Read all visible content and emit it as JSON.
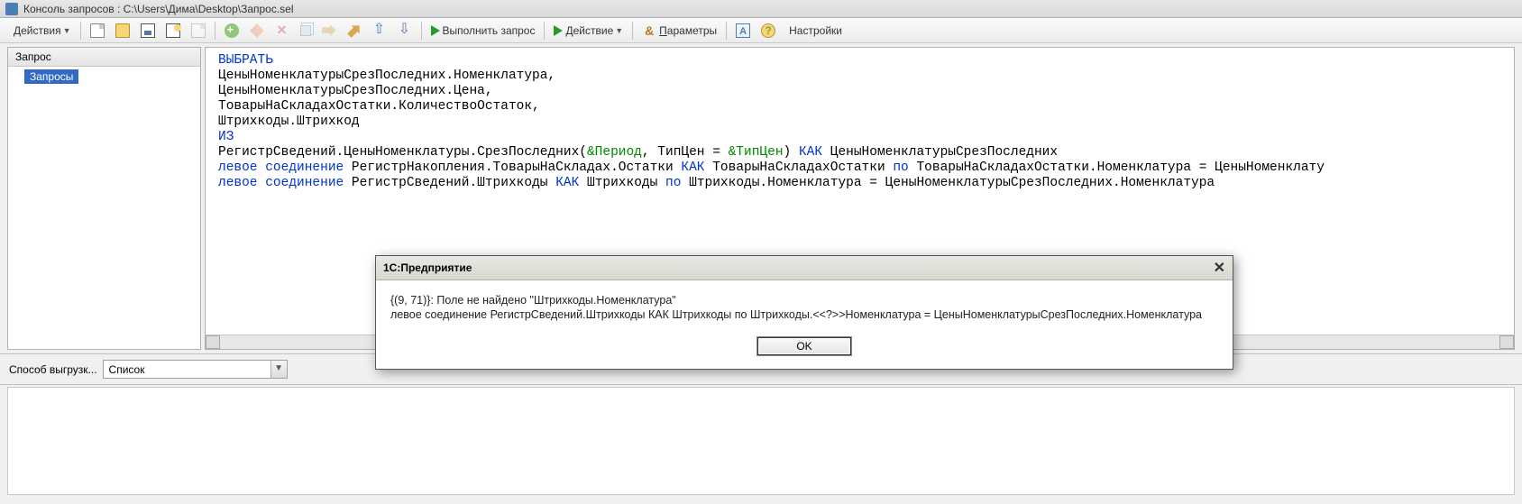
{
  "window": {
    "title": "Консоль запросов : C:\\Users\\Дима\\Desktop\\Запрос.sel"
  },
  "toolbar": {
    "actions_label": "Действия",
    "execute_label": "Выполнить запрос",
    "action_label": "Действие",
    "params_label": "Параметры",
    "settings_label": "Настройки"
  },
  "sidebar": {
    "header": "Запрос",
    "item": "Запросы"
  },
  "query": {
    "l1_kw": "ВЫБРАТЬ",
    "l2": "ЦеныНоменклатурыСрезПоследних.Номенклатура,",
    "l3": "ЦеныНоменклатурыСрезПоследних.Цена,",
    "l4": "ТоварыНаСкладахОстатки.КоличествоОстаток,",
    "l5": "Штрихкоды.Штрихкод",
    "l6_kw": "ИЗ",
    "l7a": "РегистрСведений.ЦеныНоменклатуры.СрезПоследних(",
    "l7p1": "&Период",
    "l7b": ", ТипЦен = ",
    "l7p2": "&ТипЦен",
    "l7c": ") ",
    "l7kw": "КАК",
    "l7d": " ЦеныНоменклатурыСрезПоследних",
    "l8kw1": "левое соединение",
    "l8a": " РегистрНакопления.ТоварыНаСкладах.Остатки ",
    "l8kw2": "КАК",
    "l8b": " ТоварыНаСкладахОстатки ",
    "l8kw3": "по",
    "l8c": " ТоварыНаСкладахОстатки.Номенклатура = ЦеныНоменклату",
    "l9kw1": "левое соединение",
    "l9a": " РегистрСведений.Штрихкоды ",
    "l9kw2": "КАК",
    "l9b": " Штрихкоды ",
    "l9kw3": "по",
    "l9c": " Штрихкоды.Номенклатура = ЦеныНоменклатурыСрезПоследних.Номенклатура"
  },
  "export": {
    "label": "Способ выгрузк...",
    "value": "Список"
  },
  "modal": {
    "title": "1С:Предприятие",
    "line1": "{(9, 71)}: Поле не найдено \"Штрихкоды.Номенклатура\"",
    "line2": "левое соединение РегистрСведений.Штрихкоды КАК Штрихкоды по Штрихкоды.<<?>>Номенклатура = ЦеныНоменклатурыСрезПоследних.Номенклатура",
    "ok": "OK"
  }
}
